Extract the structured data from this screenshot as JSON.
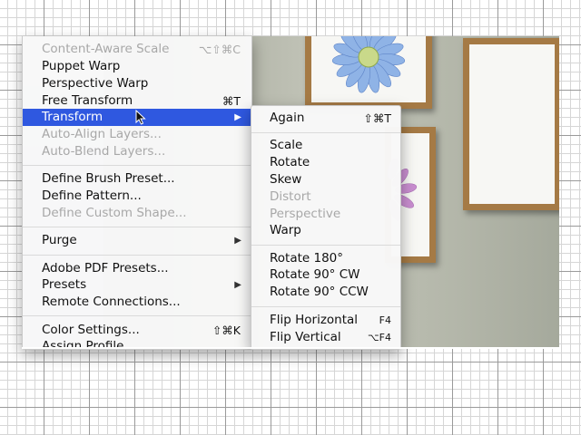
{
  "main_menu": {
    "items": [
      {
        "label": "Content-Aware Scale",
        "shortcut": "⌥⇧⌘C"
      },
      {
        "label": "Puppet Warp",
        "shortcut": ""
      },
      {
        "label": "Perspective Warp",
        "shortcut": ""
      },
      {
        "label": "Free Transform",
        "shortcut": "⌘T"
      },
      {
        "label": "Transform",
        "shortcut": ""
      },
      {
        "label": "Auto-Align Layers...",
        "shortcut": ""
      },
      {
        "label": "Auto-Blend Layers...",
        "shortcut": ""
      },
      {
        "label": "Define Brush Preset...",
        "shortcut": ""
      },
      {
        "label": "Define Pattern...",
        "shortcut": ""
      },
      {
        "label": "Define Custom Shape...",
        "shortcut": ""
      },
      {
        "label": "Purge",
        "shortcut": ""
      },
      {
        "label": "Adobe PDF Presets...",
        "shortcut": ""
      },
      {
        "label": "Presets",
        "shortcut": ""
      },
      {
        "label": "Remote Connections...",
        "shortcut": ""
      },
      {
        "label": "Color Settings...",
        "shortcut": "⇧⌘K"
      },
      {
        "label": "Assign Profile...",
        "shortcut": ""
      }
    ],
    "submenu_arrow": "▶"
  },
  "transform_submenu": {
    "items": [
      {
        "label": "Again",
        "shortcut": "⇧⌘T"
      },
      {
        "label": "Scale",
        "shortcut": ""
      },
      {
        "label": "Rotate",
        "shortcut": ""
      },
      {
        "label": "Skew",
        "shortcut": ""
      },
      {
        "label": "Distort",
        "shortcut": ""
      },
      {
        "label": "Perspective",
        "shortcut": ""
      },
      {
        "label": "Warp",
        "shortcut": ""
      },
      {
        "label": "Rotate 180°",
        "shortcut": ""
      },
      {
        "label": "Rotate 90° CW",
        "shortcut": ""
      },
      {
        "label": "Rotate 90° CCW",
        "shortcut": ""
      },
      {
        "label": "Flip Horizontal",
        "shortcut": "F4"
      },
      {
        "label": "Flip Vertical",
        "shortcut": "⌥F4"
      }
    ]
  },
  "colors": {
    "selection": "#2f58e0",
    "disabled_text": "#a8a8a8",
    "frame_wood": "#a57a45"
  },
  "icons": [
    "mouse-pointer-icon",
    "submenu-arrow-icon"
  ]
}
